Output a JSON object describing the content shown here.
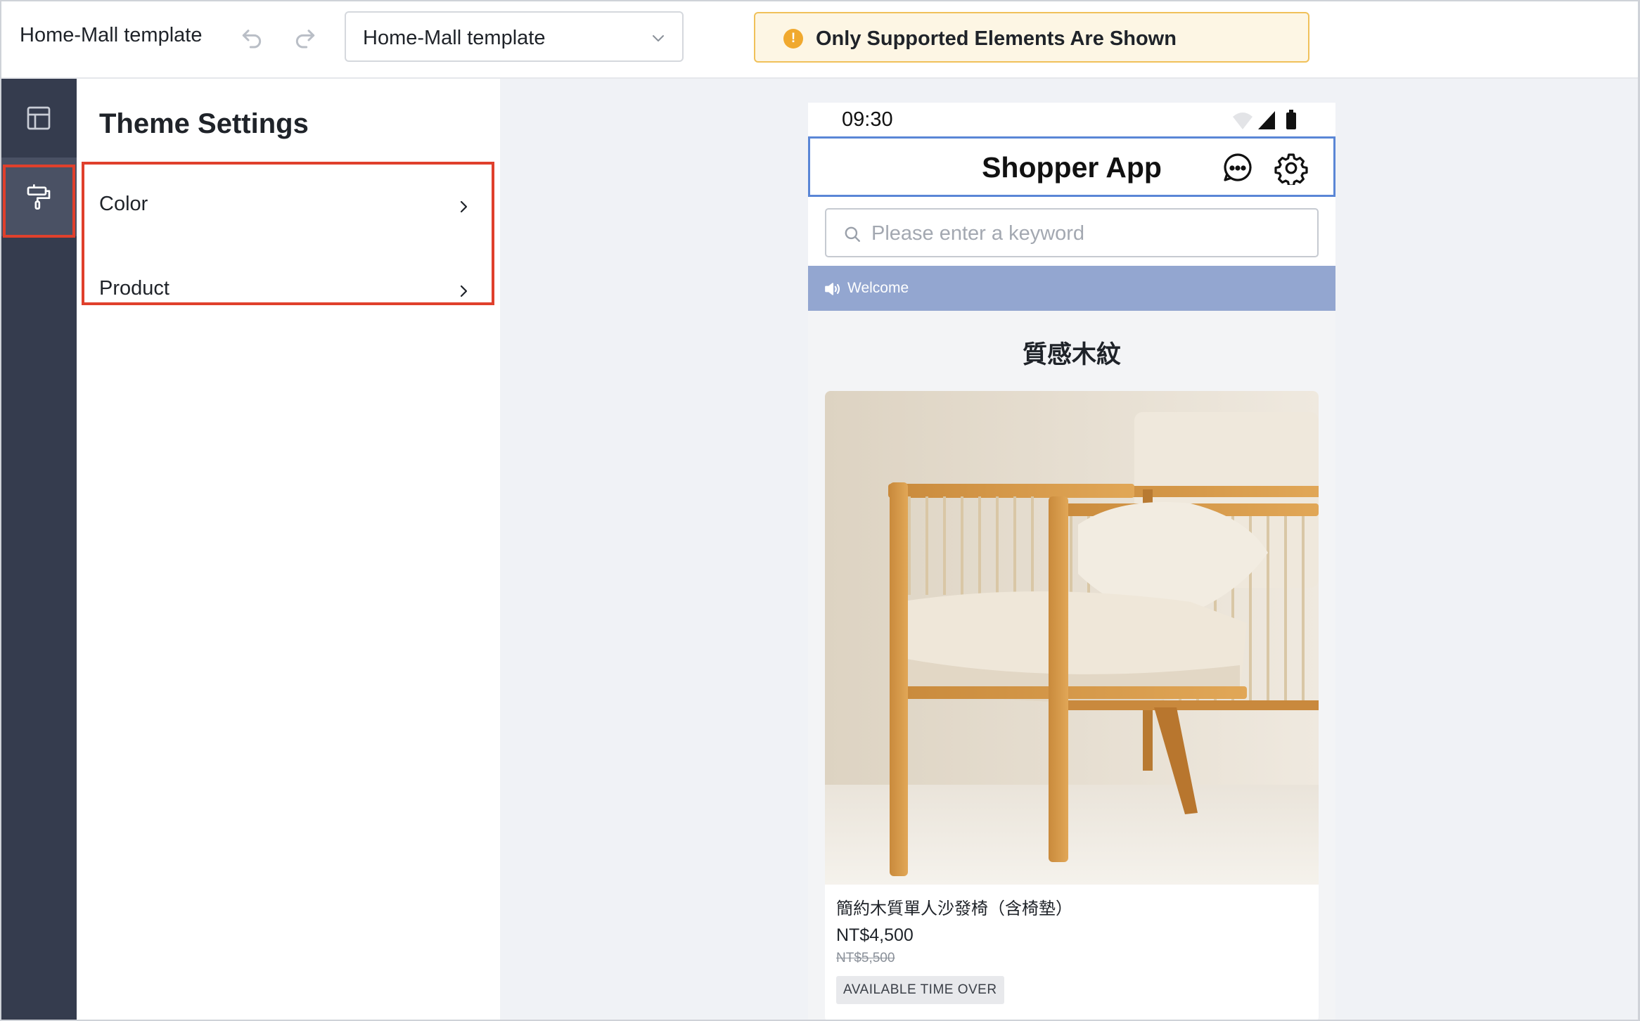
{
  "topbar": {
    "app_title": "Home-Mall template",
    "page_select_value": "Home-Mall template",
    "notice_text": "Only Supported Elements Are Shown",
    "notice_icon": "!"
  },
  "rail": {
    "items": [
      {
        "icon": "layout-icon",
        "active": false
      },
      {
        "icon": "paint-roller-icon",
        "active": true
      }
    ]
  },
  "panel": {
    "title": "Theme Settings",
    "rows": [
      {
        "label": "Color"
      },
      {
        "label": "Product"
      }
    ]
  },
  "preview": {
    "status_time": "09:30",
    "app_title": "Shopper App",
    "search_placeholder": "Please enter a keyword",
    "marquee_text": "Welcome",
    "section_title": "質感木紋",
    "product": {
      "name": "簡約木質單人沙發椅（含椅墊）",
      "price": "NT$4,500",
      "original_price": "NT$5,500",
      "tag": "AVAILABLE TIME OVER"
    }
  },
  "colors": {
    "rail_bg": "#353c4e",
    "highlight": "#e0402c",
    "appbar_border": "#5a86d6",
    "marquee_bg": "#93a6d0",
    "notice_bg": "#fdf6e4",
    "notice_border": "#f0c15a"
  }
}
